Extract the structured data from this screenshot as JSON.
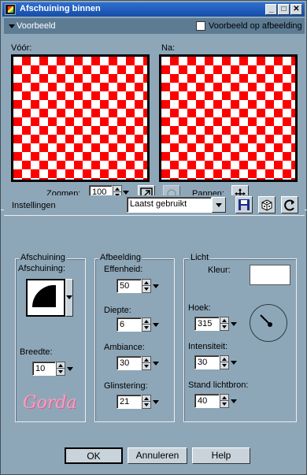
{
  "window": {
    "title": "Afschuining binnen"
  },
  "preview": {
    "header_label": "Voorbeeld",
    "checkbox_label": "Voorbeeld op afbeelding",
    "before_label": "Vóór:",
    "after_label": "Na:",
    "zoom_label": "Zoomen:",
    "zoom_value": "100",
    "pan_label": "Pannen:"
  },
  "settings": {
    "label": "Instellingen",
    "preset_value": "Laatst gebruikt"
  },
  "bevel": {
    "group_label": "Afschuining",
    "shape_label": "Afschuining:",
    "width_label": "Breedte:",
    "width_value": "10",
    "watermark": "Gorda"
  },
  "image": {
    "group_label": "Afbeelding",
    "smoothness_label": "Effenheid:",
    "smoothness_value": "50",
    "depth_label": "Diepte:",
    "depth_value": "6",
    "ambience_label": "Ambiance:",
    "ambience_value": "30",
    "shininess_label": "Glinstering:",
    "shininess_value": "21"
  },
  "light": {
    "group_label": "Licht",
    "color_label": "Kleur:",
    "angle_label": "Hoek:",
    "angle_value": "315",
    "intensity_label": "Intensiteit:",
    "intensity_value": "30",
    "elevation_label": "Stand lichtbron:",
    "elevation_value": "40"
  },
  "buttons": {
    "ok": "OK",
    "cancel": "Annuleren",
    "help": "Help"
  },
  "colors": {
    "title": "#1d5bc0",
    "background": "#8ea7b8",
    "checker_red": "#ff0000"
  }
}
